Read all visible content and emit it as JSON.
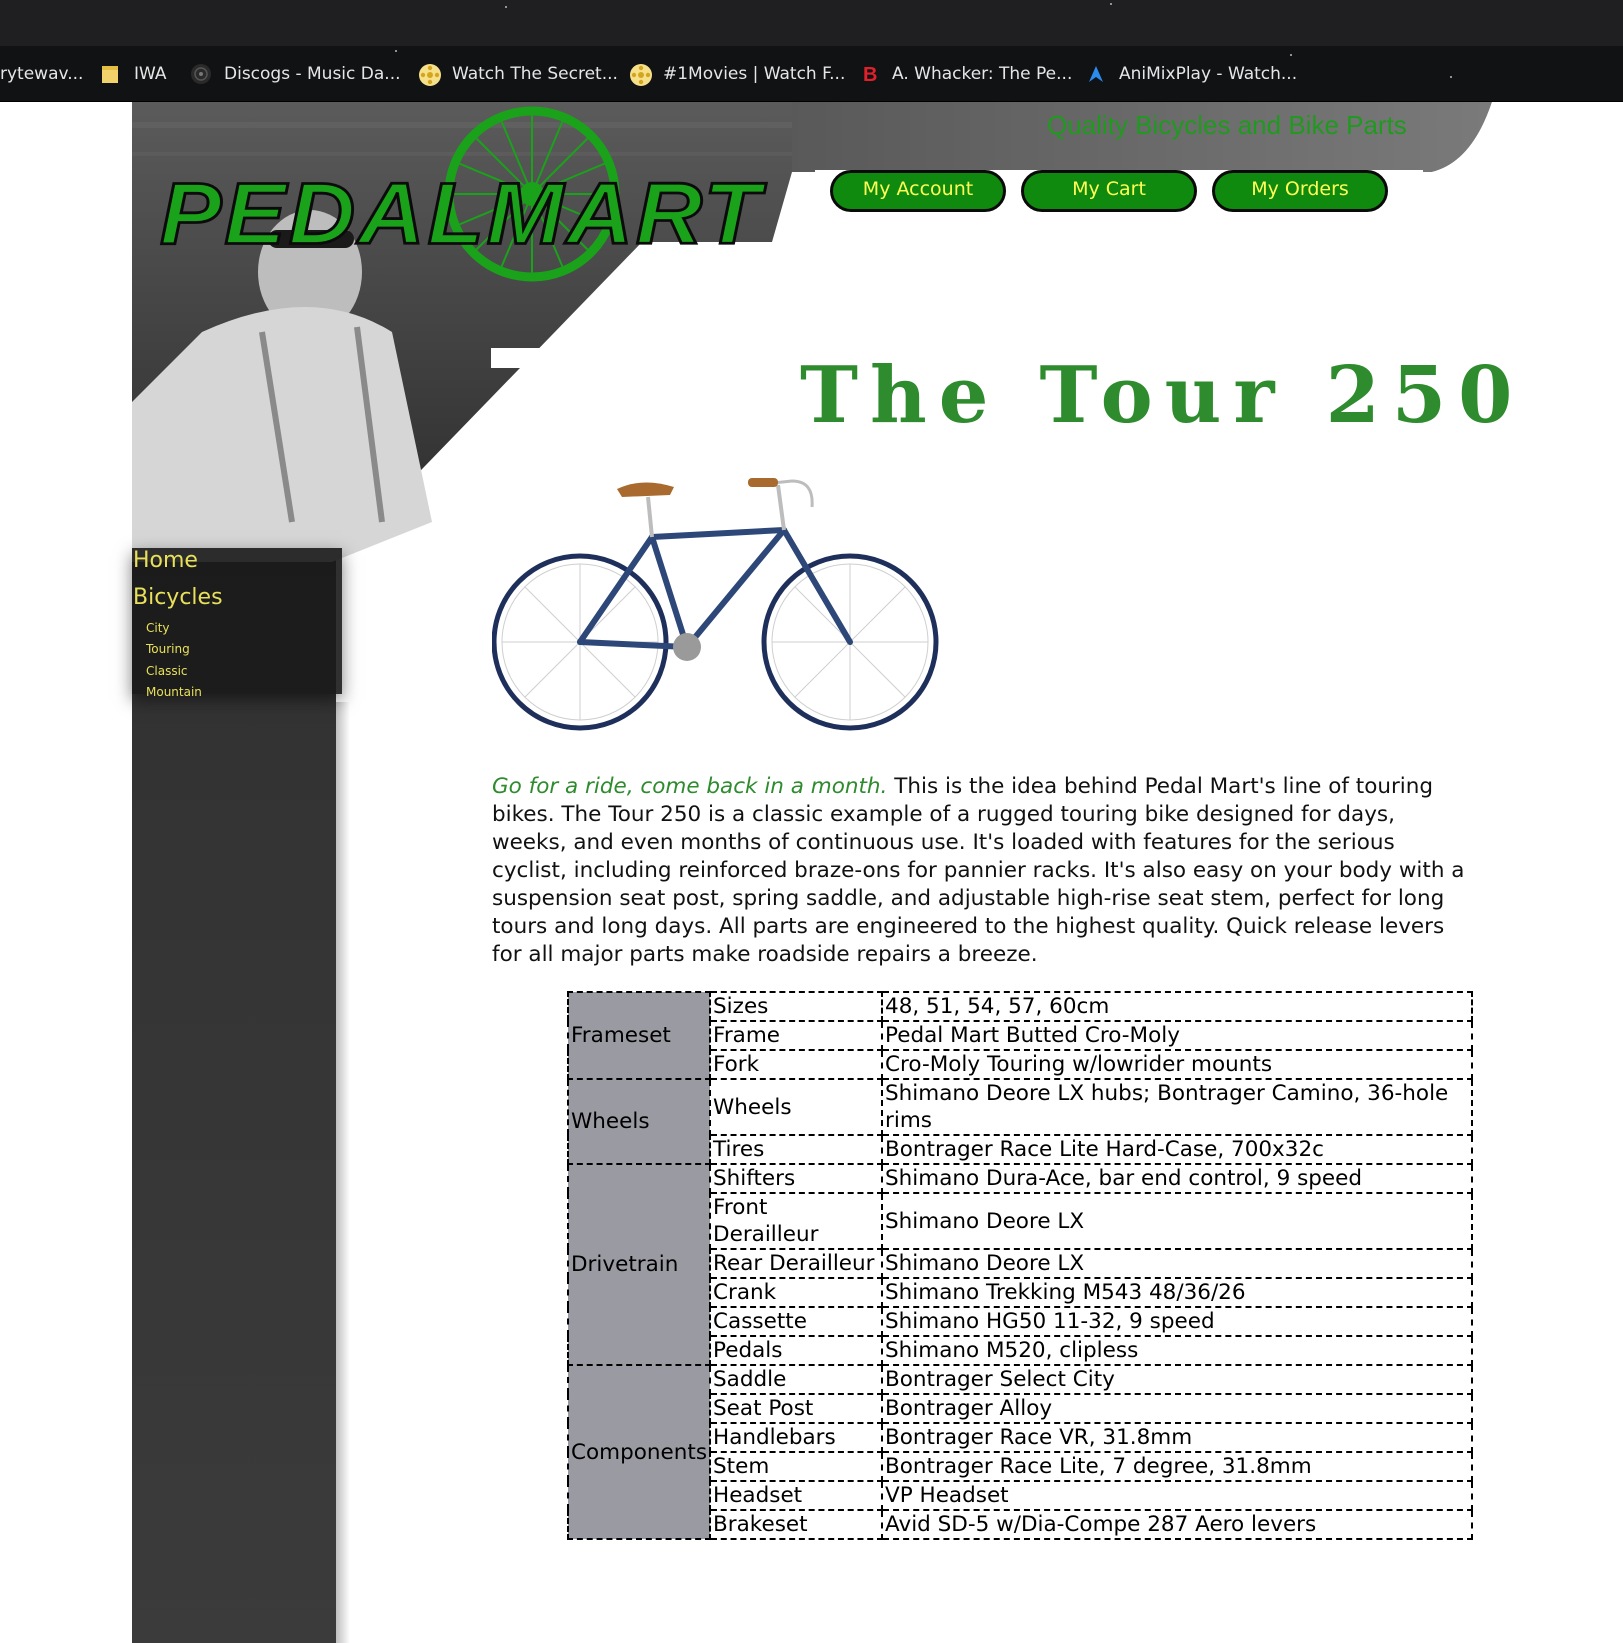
{
  "browser": {
    "bookmarks": [
      {
        "label": "rytewav...",
        "icon": "none"
      },
      {
        "label": "IWA",
        "icon": "folder-icon"
      },
      {
        "label": "Discogs - Music Da...",
        "icon": "discogs-icon"
      },
      {
        "label": "Watch The Secret...",
        "icon": "film-reel-icon"
      },
      {
        "label": "#1Movies | Watch F...",
        "icon": "film-reel-icon"
      },
      {
        "label": "A. Whacker: The Pe...",
        "icon": "letter-b-icon"
      },
      {
        "label": "AniMixPlay - Watch...",
        "icon": "animixplay-icon"
      }
    ]
  },
  "site": {
    "tagline": "Quality Bicycles and Bike Parts",
    "logo_text": "PEDALMART",
    "nav": {
      "account": "My Account",
      "cart": "My Cart",
      "orders": "My Orders"
    },
    "menu": {
      "home": "Home",
      "bicycles": "Bicycles",
      "sub": [
        "City",
        "Touring",
        "Classic",
        "Mountain"
      ]
    },
    "colors": {
      "brand_green": "#1aa21a",
      "nav_text": "#ffff55",
      "menu_text": "#e8e05a",
      "title_green": "#2e8b2e"
    }
  },
  "product": {
    "title": "The Tour 250",
    "lead": "Go for a ride, come back in a month.",
    "description": "This is the idea behind Pedal Mart's line of touring bikes. The Tour 250 is a classic example of a rugged touring bike designed for days, weeks, and even months of continuous use. It's loaded with features for the serious cyclist, including reinforced braze-ons for pannier racks. It's also easy on your body with a suspension seat post, spring saddle, and adjustable high-rise seat stem, perfect for long tours and long days. All parts are engineered to the highest quality. Quick release levers for all major parts make roadside repairs a breeze."
  },
  "specs": [
    {
      "group": "Frameset",
      "rows": [
        {
          "name": "Sizes",
          "value": "48, 51, 54, 57, 60cm"
        },
        {
          "name": "Frame",
          "value": "Pedal Mart Butted Cro-Moly"
        },
        {
          "name": "Fork",
          "value": "Cro-Moly Touring w/lowrider mounts"
        }
      ]
    },
    {
      "group": "Wheels",
      "rows": [
        {
          "name": "Wheels",
          "value": "Shimano Deore LX hubs; Bontrager Camino, 36-hole rims"
        },
        {
          "name": "Tires",
          "value": "Bontrager Race Lite Hard-Case, 700x32c"
        }
      ]
    },
    {
      "group": "Drivetrain",
      "rows": [
        {
          "name": "Shifters",
          "value": "Shimano Dura-Ace, bar end control, 9 speed"
        },
        {
          "name": "Front Derailleur",
          "value": "Shimano Deore LX"
        },
        {
          "name": "Rear Derailleur",
          "value": "Shimano Deore LX"
        },
        {
          "name": "Crank",
          "value": "Shimano Trekking M543 48/36/26"
        },
        {
          "name": "Cassette",
          "value": "Shimano HG50 11-32, 9 speed"
        },
        {
          "name": "Pedals",
          "value": "Shimano M520, clipless"
        }
      ]
    },
    {
      "group": "Components",
      "rows": [
        {
          "name": "Saddle",
          "value": "Bontrager Select City"
        },
        {
          "name": "Seat Post",
          "value": "Bontrager Alloy"
        },
        {
          "name": "Handlebars",
          "value": "Bontrager Race VR, 31.8mm"
        },
        {
          "name": "Stem",
          "value": "Bontrager Race Lite, 7 degree, 31.8mm"
        },
        {
          "name": "Headset",
          "value": "VP Headset"
        },
        {
          "name": "Brakeset",
          "value": "Avid SD-5 w/Dia-Compe 287 Aero levers"
        }
      ]
    }
  ]
}
